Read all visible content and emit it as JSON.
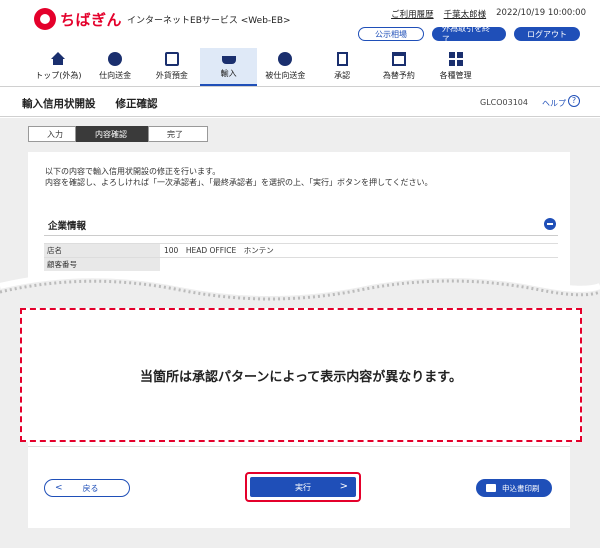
{
  "header": {
    "logo_text": "ちばぎん",
    "service_name": "インターネットEBサービス <Web-EB>",
    "usage_history": "ご利用履歴",
    "user_name": "千葉太郎様",
    "datetime": "2022/10/19 10:00:00",
    "btn_public_rate": "公示相場",
    "btn_end_forex": "外為取引を終了",
    "btn_logout": "ログアウト"
  },
  "nav": {
    "items": [
      {
        "label": "トップ(外為)",
        "icon": "home-icon"
      },
      {
        "label": "仕向送金",
        "icon": "coin-icon"
      },
      {
        "label": "外貨預金",
        "icon": "deposit-icon"
      },
      {
        "label": "輸入",
        "icon": "ship-icon"
      },
      {
        "label": "被仕向送金",
        "icon": "coin-icon"
      },
      {
        "label": "承認",
        "icon": "document-icon"
      },
      {
        "label": "為替予約",
        "icon": "calendar-icon"
      },
      {
        "label": "各種管理",
        "icon": "grid-icon"
      }
    ]
  },
  "page": {
    "title": "輸入信用状開設",
    "subtitle": "修正確認",
    "code": "GLCO03104",
    "help": "ヘルプ"
  },
  "steps": [
    "入力",
    "内容確認",
    "完了"
  ],
  "intro": {
    "line1": "以下の内容で輸入信用状開設の修正を行います。",
    "line2": "内容を確認し、よろしければ「一次承認者」、「最終承認者」を選択の上、「実行」ボタンを押してください。"
  },
  "section": {
    "title": "企業情報"
  },
  "table": {
    "rows": [
      {
        "label": "店名",
        "value": "100　HEAD OFFICE　ホンテン"
      },
      {
        "label": "顧客番号",
        "value": ""
      }
    ]
  },
  "notice": "当箇所は承認パターンによって表示内容が異なります。",
  "buttons": {
    "back": "戻る",
    "execute": "実行",
    "print": "申込書印刷"
  },
  "colors": {
    "brand_red": "#e4002b",
    "primary_blue": "#1f4fb8"
  }
}
